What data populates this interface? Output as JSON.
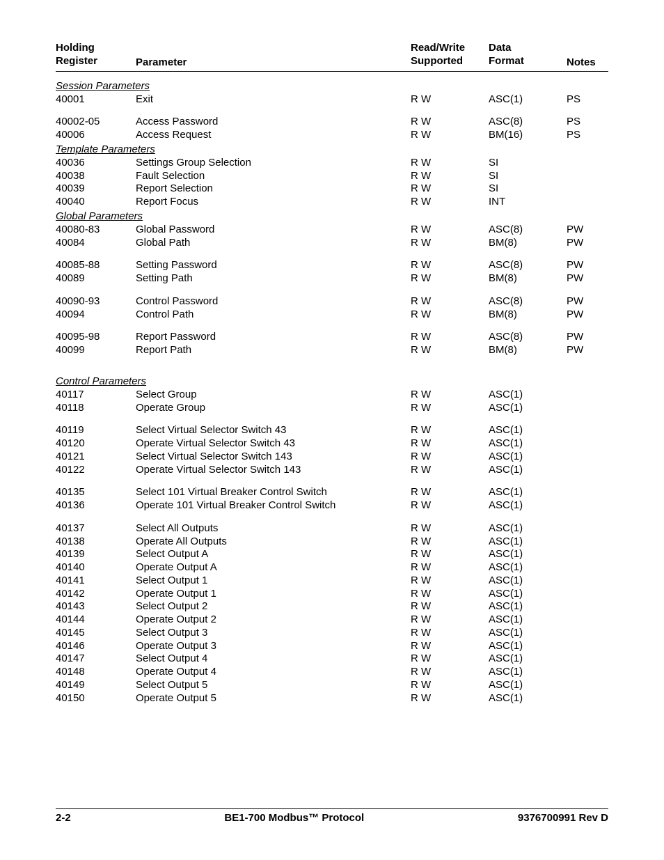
{
  "header": {
    "col1_l1": "Holding",
    "col1_l2": "Register",
    "col2": "Parameter",
    "col3_l1": "Read/Write",
    "col3_l2": "Supported",
    "col4_l1": "Data",
    "col4_l2": "Format",
    "col5": "Notes"
  },
  "sections": [
    {
      "title": "Session Parameters",
      "groups": [
        [
          {
            "reg": "40001",
            "param": "Exit",
            "rw": "R W",
            "fmt": "ASC(1)",
            "notes": "PS"
          }
        ],
        [
          {
            "reg": "40002-05",
            "param": "Access Password",
            "rw": "R W",
            "fmt": "ASC(8)",
            "notes": "PS"
          },
          {
            "reg": "40006",
            "param": "Access Request",
            "rw": "R W",
            "fmt": "BM(16)",
            "notes": "PS"
          }
        ]
      ]
    },
    {
      "title": "Template Parameters",
      "groups": [
        [
          {
            "reg": "40036",
            "param": "Settings Group Selection",
            "rw": "R W",
            "fmt": "SI",
            "notes": ""
          },
          {
            "reg": "40038",
            "param": "Fault Selection",
            "rw": "R W",
            "fmt": "SI",
            "notes": ""
          },
          {
            "reg": "40039",
            "param": "Report Selection",
            "rw": "R W",
            "fmt": "SI",
            "notes": ""
          },
          {
            "reg": "40040",
            "param": "Report Focus",
            "rw": "R W",
            "fmt": "INT",
            "notes": ""
          }
        ]
      ]
    },
    {
      "title": "Global Parameters",
      "groups": [
        [
          {
            "reg": "40080-83",
            "param": "Global Password",
            "rw": "R W",
            "fmt": "ASC(8)",
            "notes": "PW"
          },
          {
            "reg": "40084",
            "param": "Global Path",
            "rw": "R W",
            "fmt": "BM(8)",
            "notes": "PW"
          }
        ],
        [
          {
            "reg": "40085-88",
            "param": "Setting Password",
            "rw": "R W",
            "fmt": "ASC(8)",
            "notes": "PW"
          },
          {
            "reg": "40089",
            "param": "Setting Path",
            "rw": "R W",
            "fmt": "BM(8)",
            "notes": "PW"
          }
        ],
        [
          {
            "reg": "40090-93",
            "param": "Control Password",
            "rw": "R W",
            "fmt": "ASC(8)",
            "notes": "PW"
          },
          {
            "reg": "40094",
            "param": "Control Path",
            "rw": "R W",
            "fmt": "BM(8)",
            "notes": "PW"
          }
        ],
        [
          {
            "reg": "40095-98",
            "param": "Report Password",
            "rw": "R W",
            "fmt": "ASC(8)",
            "notes": "PW"
          },
          {
            "reg": "40099",
            "param": "Report Path",
            "rw": "R W",
            "fmt": "BM(8)",
            "notes": "PW"
          }
        ]
      ]
    },
    {
      "title": "Control Parameters",
      "preGap": true,
      "groups": [
        [
          {
            "reg": "40117",
            "param": "Select Group",
            "rw": "R W",
            "fmt": "ASC(1)",
            "notes": ""
          },
          {
            "reg": "40118",
            "param": "Operate Group",
            "rw": "R W",
            "fmt": "ASC(1)",
            "notes": ""
          }
        ],
        [
          {
            "reg": "40119",
            "param": "Select Virtual Selector Switch 43",
            "rw": "R W",
            "fmt": "ASC(1)",
            "notes": ""
          },
          {
            "reg": "40120",
            "param": "Operate Virtual Selector Switch 43",
            "rw": "R W",
            "fmt": "ASC(1)",
            "notes": ""
          },
          {
            "reg": "40121",
            "param": "Select Virtual Selector Switch 143",
            "rw": "R W",
            "fmt": "ASC(1)",
            "notes": ""
          },
          {
            "reg": "40122",
            "param": "Operate Virtual Selector Switch 143",
            "rw": "R W",
            "fmt": "ASC(1)",
            "notes": ""
          }
        ],
        [
          {
            "reg": "40135",
            "param": "Select 101 Virtual Breaker Control Switch",
            "rw": "R W",
            "fmt": "ASC(1)",
            "notes": ""
          },
          {
            "reg": "40136",
            "param": "Operate 101 Virtual Breaker Control Switch",
            "rw": "R W",
            "fmt": "ASC(1)",
            "notes": ""
          }
        ],
        [
          {
            "reg": "40137",
            "param": "Select All Outputs",
            "rw": "R W",
            "fmt": "ASC(1)",
            "notes": ""
          },
          {
            "reg": "40138",
            "param": "Operate All Outputs",
            "rw": "R W",
            "fmt": "ASC(1)",
            "notes": ""
          },
          {
            "reg": "40139",
            "param": "Select Output A",
            "rw": "R W",
            "fmt": "ASC(1)",
            "notes": ""
          },
          {
            "reg": "40140",
            "param": "Operate Output A",
            "rw": "R W",
            "fmt": "ASC(1)",
            "notes": ""
          },
          {
            "reg": "40141",
            "param": "Select Output 1",
            "rw": "R W",
            "fmt": "ASC(1)",
            "notes": ""
          },
          {
            "reg": "40142",
            "param": "Operate Output 1",
            "rw": "R W",
            "fmt": "ASC(1)",
            "notes": ""
          },
          {
            "reg": "40143",
            "param": "Select Output 2",
            "rw": "R W",
            "fmt": "ASC(1)",
            "notes": ""
          },
          {
            "reg": "40144",
            "param": "Operate Output 2",
            "rw": "R W",
            "fmt": "ASC(1)",
            "notes": ""
          },
          {
            "reg": "40145",
            "param": "Select Output 3",
            "rw": "R W",
            "fmt": "ASC(1)",
            "notes": ""
          },
          {
            "reg": "40146",
            "param": "Operate Output 3",
            "rw": "R W",
            "fmt": "ASC(1)",
            "notes": ""
          },
          {
            "reg": "40147",
            "param": "Select Output 4",
            "rw": "R W",
            "fmt": "ASC(1)",
            "notes": ""
          },
          {
            "reg": "40148",
            "param": "Operate Output 4",
            "rw": "R W",
            "fmt": "ASC(1)",
            "notes": ""
          },
          {
            "reg": "40149",
            "param": "Select Output 5",
            "rw": "R W",
            "fmt": "ASC(1)",
            "notes": ""
          },
          {
            "reg": "40150",
            "param": "Operate Output 5",
            "rw": "R W",
            "fmt": "ASC(1)",
            "notes": ""
          }
        ]
      ]
    }
  ],
  "footer": {
    "left": "2-2",
    "center": "BE1-700 Modbus™ Protocol",
    "right": "9376700991 Rev D"
  }
}
